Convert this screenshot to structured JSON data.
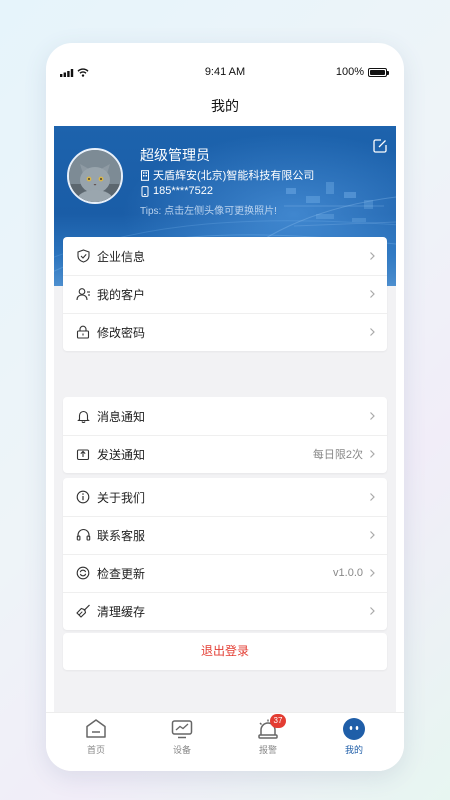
{
  "status_bar": {
    "time": "9:41 AM",
    "battery": "100%"
  },
  "nav": {
    "title": "我的"
  },
  "profile": {
    "name": "超级管理员",
    "company": "天盾辉安(北京)智能科技有限公司",
    "phone": "185****7522",
    "tips": "Tips:  点击左侧头像可更换照片!"
  },
  "groups": [
    [
      {
        "label": "企业信息",
        "icon": "shield-icon"
      },
      {
        "label": "我的客户",
        "icon": "customers-icon"
      },
      {
        "label": "修改密码",
        "icon": "lock-icon"
      }
    ],
    [
      {
        "label": "消息通知",
        "icon": "bell-icon"
      },
      {
        "label": "发送通知",
        "icon": "send-icon",
        "value": "每日限2次"
      }
    ],
    [
      {
        "label": "关于我们",
        "icon": "info-icon"
      },
      {
        "label": "联系客服",
        "icon": "headset-icon"
      },
      {
        "label": "检查更新",
        "icon": "update-icon",
        "value": "v1.0.0"
      },
      {
        "label": "清理缓存",
        "icon": "broom-icon"
      }
    ]
  ],
  "logout": {
    "label": "退出登录"
  },
  "tabs": [
    {
      "label": "首页",
      "icon": "home-icon"
    },
    {
      "label": "设备",
      "icon": "device-icon"
    },
    {
      "label": "报警",
      "icon": "alarm-icon",
      "badge": "37"
    },
    {
      "label": "我的",
      "icon": "profile-icon",
      "active": true
    }
  ],
  "colors": {
    "brand": "#1f5ea8",
    "danger": "#e33d33",
    "banner": "#1d63ad"
  }
}
